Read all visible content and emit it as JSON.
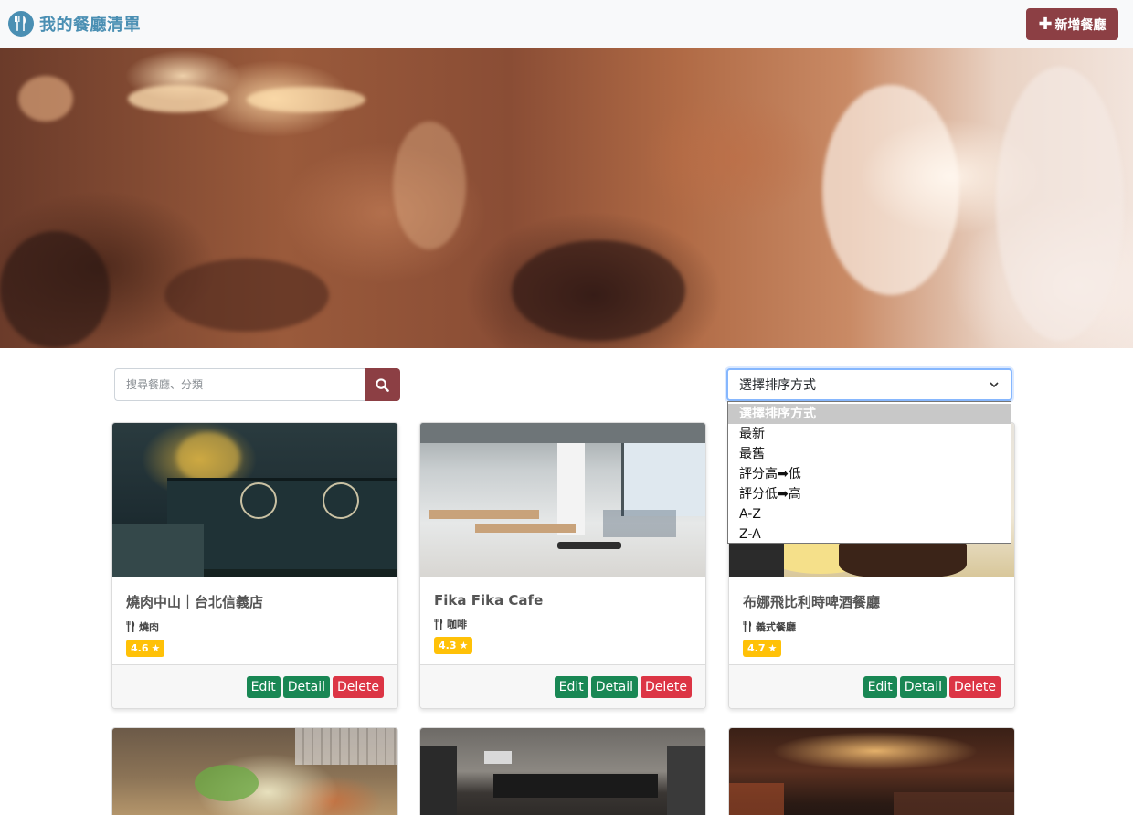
{
  "navbar": {
    "brand_title": "我的餐廳清單",
    "new_button_label": "新增餐廳"
  },
  "search": {
    "placeholder": "搜尋餐廳、分類"
  },
  "sort": {
    "selected": "選擇排序方式",
    "options": [
      "選擇排序方式",
      "最新",
      "最舊",
      "評分高➡低",
      "評分低➡高",
      "A-Z",
      "Z-A"
    ]
  },
  "restaurants": [
    {
      "name": "燒肉中山｜台北信義店",
      "category": "燒肉",
      "rating": "4.6"
    },
    {
      "name": "Fika Fika Cafe",
      "category": "咖啡",
      "rating": "4.3"
    },
    {
      "name": "布娜飛比利時啤酒餐廳",
      "category": "義式餐廳",
      "rating": "4.7"
    }
  ],
  "card_actions": {
    "edit": "Edit",
    "detail": "Detail",
    "delete": "Delete"
  },
  "colors": {
    "brand": "#4a8fb3",
    "primary_button": "#8c3f44",
    "edit_button": "#198754",
    "delete_button": "#dc3545",
    "rating_badge": "#ffc107"
  }
}
